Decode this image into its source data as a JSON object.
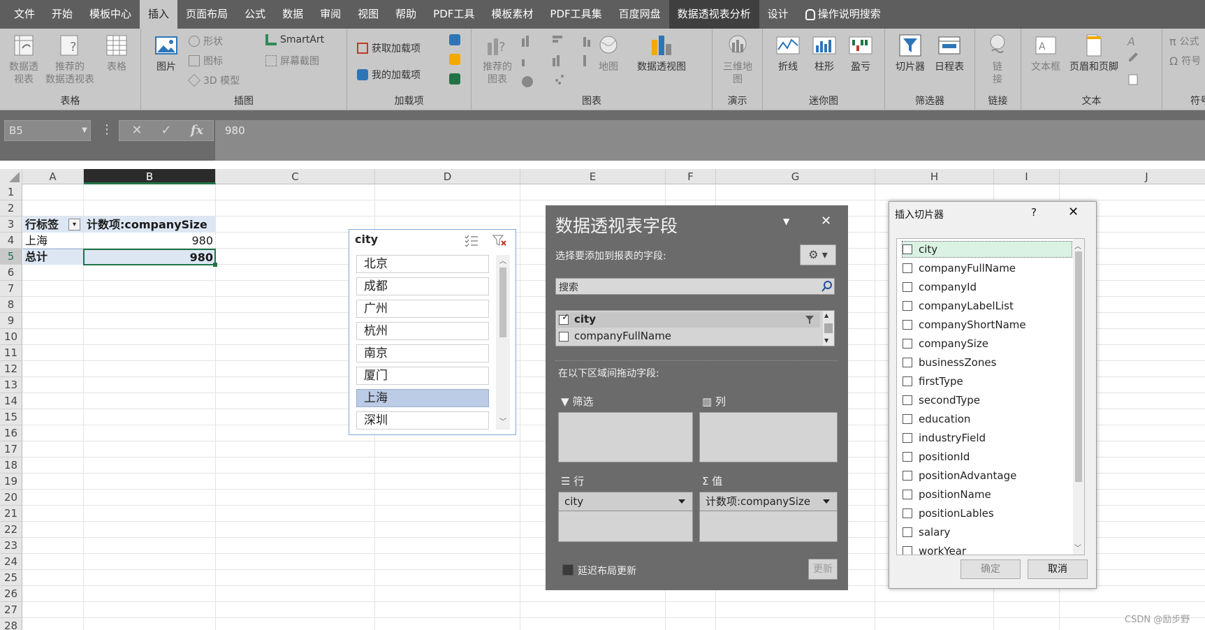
{
  "menu": [
    "文件",
    "开始",
    "模板中心",
    "插入",
    "页面布局",
    "公式",
    "数据",
    "审阅",
    "视图",
    "帮助",
    "PDF工具",
    "模板素材",
    "PDF工具集",
    "百度网盘",
    "数据透视表分析",
    "设计"
  ],
  "menu_active": "插入",
  "tell_me": "操作说明搜索",
  "ribbon": {
    "tables": {
      "group": "表格",
      "pivot": "数据透\n视表",
      "recommended_pivot": "推荐的\n数据透视表",
      "table": "表格"
    },
    "illustrations": {
      "group": "插图",
      "picture": "图片",
      "shapes": "形状",
      "icons": "图标",
      "models3d": "3D 模型",
      "smartart": "SmartArt",
      "screenshot": "屏幕截图"
    },
    "addins": {
      "group": "加载项",
      "get": "获取加载项",
      "mine": "我的加载项"
    },
    "charts": {
      "group": "图表",
      "recommended": "推荐的\n图表",
      "map": "地图",
      "pivotchart": "数据透视图"
    },
    "tours": {
      "group": "演示",
      "map3d": "三维地\n图"
    },
    "sparklines": {
      "group": "迷你图",
      "line": "折线",
      "column": "柱形",
      "winloss": "盈亏"
    },
    "filters": {
      "group": "筛选器",
      "slicer": "切片器",
      "timeline": "日程表"
    },
    "links": {
      "group": "链接",
      "link": "链\n接"
    },
    "text": {
      "group": "文本",
      "textbox": "文本框",
      "header": "页眉和页脚"
    },
    "symbols": {
      "group": "符号",
      "equation": "公式",
      "symbol": "符号"
    }
  },
  "formula_bar": {
    "cell_ref": "B5",
    "value": "980"
  },
  "columns": [
    "A",
    "B",
    "C",
    "D",
    "E",
    "F",
    "G",
    "H",
    "I",
    "J"
  ],
  "rows": [
    "1",
    "2",
    "3",
    "4",
    "5",
    "6",
    "7",
    "8",
    "9",
    "10",
    "11",
    "12",
    "13",
    "14",
    "15",
    "16",
    "17",
    "18",
    "19",
    "20",
    "21",
    "22",
    "23",
    "24",
    "25",
    "26",
    "27",
    "28"
  ],
  "pivot_table": {
    "row_label_header": "行标签",
    "value_header": "计数项:companySize",
    "row": {
      "label": "上海",
      "value": "980"
    },
    "total": {
      "label": "总计",
      "value": "980"
    }
  },
  "slicer": {
    "title": "city",
    "items": [
      "北京",
      "成都",
      "广州",
      "杭州",
      "南京",
      "厦门",
      "上海",
      "深圳"
    ],
    "selected": "上海"
  },
  "pivot_pane": {
    "title": "数据透视表字段",
    "subtitle": "选择要添加到报表的字段:",
    "search_placeholder": "搜索",
    "fields": [
      {
        "name": "city",
        "checked": true
      },
      {
        "name": "companyFullName",
        "checked": false
      }
    ],
    "drag_label": "在以下区域间拖动字段:",
    "zones": {
      "filter": "筛选",
      "columns": "列",
      "rows": "行",
      "values": "值"
    },
    "rows_value": "city",
    "values_value": "计数项:companySize",
    "defer": "延迟布局更新",
    "update": "更新"
  },
  "slicer_dialog": {
    "title": "插入切片器",
    "help": "?",
    "fields": [
      "city",
      "companyFullName",
      "companyId",
      "companyLabelList",
      "companyShortName",
      "companySize",
      "businessZones",
      "firstType",
      "secondType",
      "education",
      "industryField",
      "positionId",
      "positionAdvantage",
      "positionName",
      "positionLables",
      "salary",
      "workYear"
    ],
    "ok": "确定",
    "cancel": "取消"
  },
  "watermark": "CSDN @励步野",
  "colors": {
    "excel_green": "#217346",
    "dark_bar": "#5e5e5e",
    "ribbon": "#c8c8c8",
    "selection": "#bccbe6"
  }
}
